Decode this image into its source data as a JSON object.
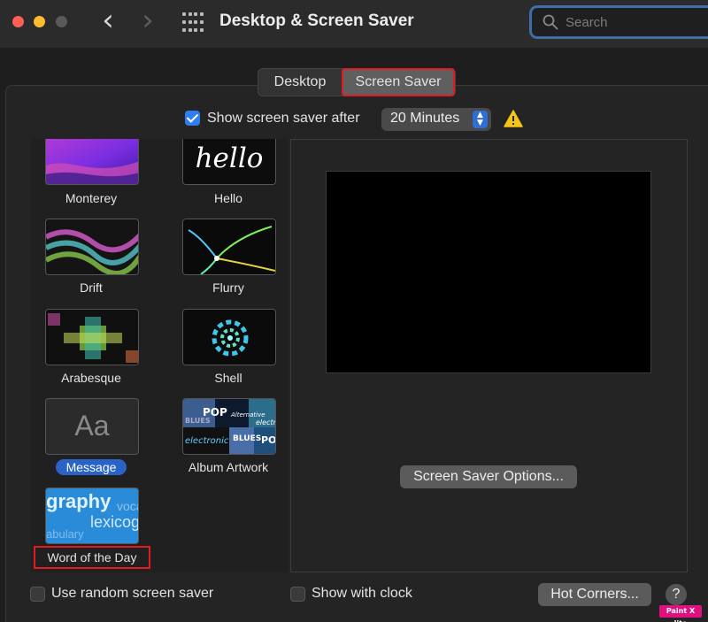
{
  "window": {
    "title": "Desktop & Screen Saver"
  },
  "search": {
    "placeholder": "Search"
  },
  "tabs": [
    {
      "label": "Desktop"
    },
    {
      "label": "Screen Saver"
    }
  ],
  "show_after": {
    "label": "Show screen saver after",
    "checked": true,
    "value": "20 Minutes"
  },
  "savers": [
    {
      "name": "Monterey"
    },
    {
      "name": "Hello",
      "thumb_text": "hello"
    },
    {
      "name": "Drift"
    },
    {
      "name": "Flurry"
    },
    {
      "name": "Arabesque"
    },
    {
      "name": "Shell"
    },
    {
      "name": "Message",
      "thumb_text": "Aa",
      "selected": true
    },
    {
      "name": "Album Artwork",
      "thumb_text": [
        "POP",
        "Alternative",
        "BLUES",
        "electronic",
        "electro",
        "BLUES",
        "PO"
      ]
    },
    {
      "name": "Word of the Day",
      "thumb_text": [
        "graphy",
        "voca",
        "lexicog",
        "abulary"
      ]
    }
  ],
  "options_button": "Screen Saver Options...",
  "footer": {
    "random_label": "Use random screen saver",
    "clock_label": "Show with clock",
    "hot_corners": "Hot Corners...",
    "help": "?"
  },
  "watermark": "Paint X lite",
  "colors": {
    "accent": "#2e7ef0",
    "highlight_box": "#e01b24",
    "selection": "#2a63c8"
  }
}
